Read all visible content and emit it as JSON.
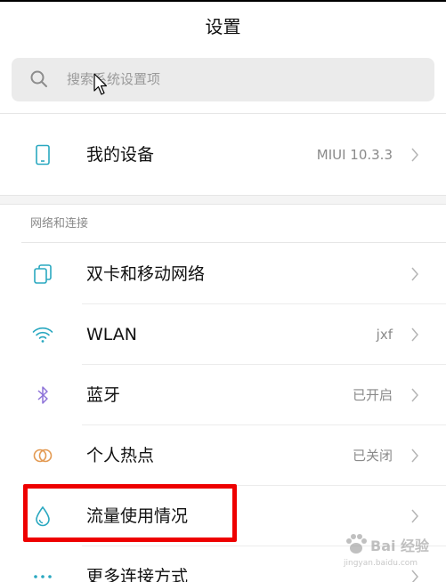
{
  "header": {
    "title": "设置"
  },
  "search": {
    "placeholder": "搜索系统设置项"
  },
  "device": {
    "label": "我的设备",
    "value": "MIUI 10.3.3"
  },
  "network": {
    "section_label": "网络和连接",
    "items": [
      {
        "label": "双卡和移动网络",
        "value": "",
        "icon": "dual-sim-icon"
      },
      {
        "label": "WLAN",
        "value": "jxf",
        "icon": "wifi-icon"
      },
      {
        "label": "蓝牙",
        "value": "已开启",
        "icon": "bluetooth-icon"
      },
      {
        "label": "个人热点",
        "value": "已关闭",
        "icon": "hotspot-icon"
      },
      {
        "label": "流量使用情况",
        "value": "",
        "icon": "data-usage-icon"
      },
      {
        "label": "更多连接方式",
        "value": "",
        "icon": "more-icon"
      }
    ]
  },
  "watermark": {
    "text": "Bai 经验",
    "sub": "jingyan.baidu.com"
  },
  "colors": {
    "accent": "#2aa8c0",
    "bluetooth": "#8d72d8",
    "hotspot": "#e39a52",
    "highlight": "#ee0000"
  }
}
